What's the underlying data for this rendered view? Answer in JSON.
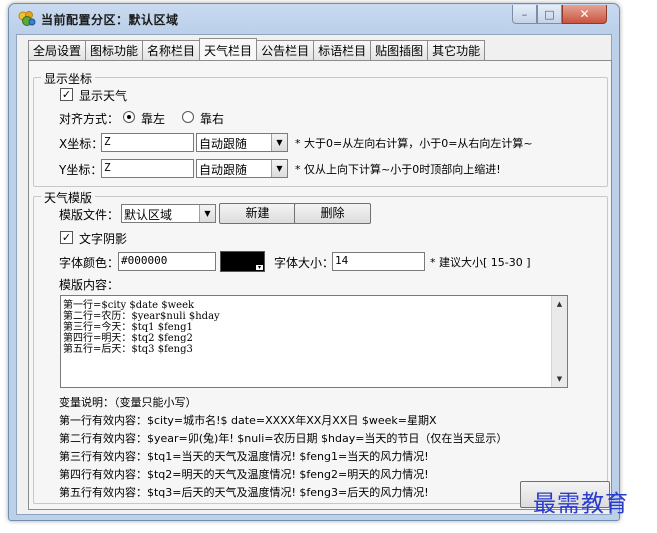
{
  "window": {
    "title": "当前配置分区：默认区域",
    "minimize_glyph": "–",
    "maximize_glyph": "□",
    "close_glyph": "✕"
  },
  "tabs": [
    {
      "label": "全局设置",
      "active": false
    },
    {
      "label": "图标功能",
      "active": false
    },
    {
      "label": "名称栏目",
      "active": false
    },
    {
      "label": "天气栏目",
      "active": true
    },
    {
      "label": "公告栏目",
      "active": false
    },
    {
      "label": "标语栏目",
      "active": false
    },
    {
      "label": "贴图插图",
      "active": false
    },
    {
      "label": "其它功能",
      "active": false
    }
  ],
  "display_group": {
    "title": "显示坐标",
    "show_weather": {
      "label": "显示天气",
      "checked": true,
      "mark": "✓"
    },
    "align_label": "对齐方式：",
    "align_left": {
      "label": "靠左",
      "selected": true
    },
    "align_right": {
      "label": "靠右",
      "selected": false
    },
    "x": {
      "label": "X坐标：",
      "value": "Z",
      "mode": "自动跟随",
      "note": "* 大于0=从左向右计算，小于0=从右向左计算~"
    },
    "y": {
      "label": "Y坐标：",
      "value": "Z",
      "mode": "自动跟随",
      "note": "* 仅从上向下计算~小于0时顶部向上缩进!"
    }
  },
  "template_group": {
    "title": "天气模版",
    "file_label": "模版文件：",
    "file_value": "默认区域",
    "new_button": "新建",
    "delete_button": "删除",
    "text_shadow": {
      "label": "文字阴影",
      "checked": true,
      "mark": "✓"
    },
    "font_color_label": "字体颜色：",
    "font_color_value": "#000000",
    "font_size_label": "字体大小：",
    "font_size_value": "14",
    "font_size_hint": "* 建议大小[ 15-30 ]",
    "content_label": "模版内容：",
    "content_lines": [
      "第一行=$city $date $week",
      "第二行=农历：$year$nuli $hday",
      "第三行=今天：$tq1 $feng1",
      "第四行=明天：$tq2 $feng2",
      "第五行=后天：$tq3 $feng3"
    ],
    "vars_title": "变量说明：（变量只能小写）",
    "vars_lines": [
      "第一行有效内容：$city=城市名!$ date=XXXX年XX月XX日 $week=星期X",
      "第二行有效内容：$year=卯(兔)年! $nuli=农历日期 $hday=当天的节日（仅在当天显示）",
      "第三行有效内容：$tq1=当天的天气及温度情况!  $feng1=当天的风力情况!",
      "第四行有效内容：$tq2=明天的天气及温度情况!  $feng2=明天的风力情况!",
      "第五行有效内容：$tq3=后天的天气及温度情况!  $feng3=后天的风力情况!"
    ]
  },
  "watermark": "最需教育",
  "icons": {
    "combo_arrow": "▼",
    "scroll_up": "▲",
    "scroll_down": "▼",
    "swatch_arrow": "▾"
  }
}
